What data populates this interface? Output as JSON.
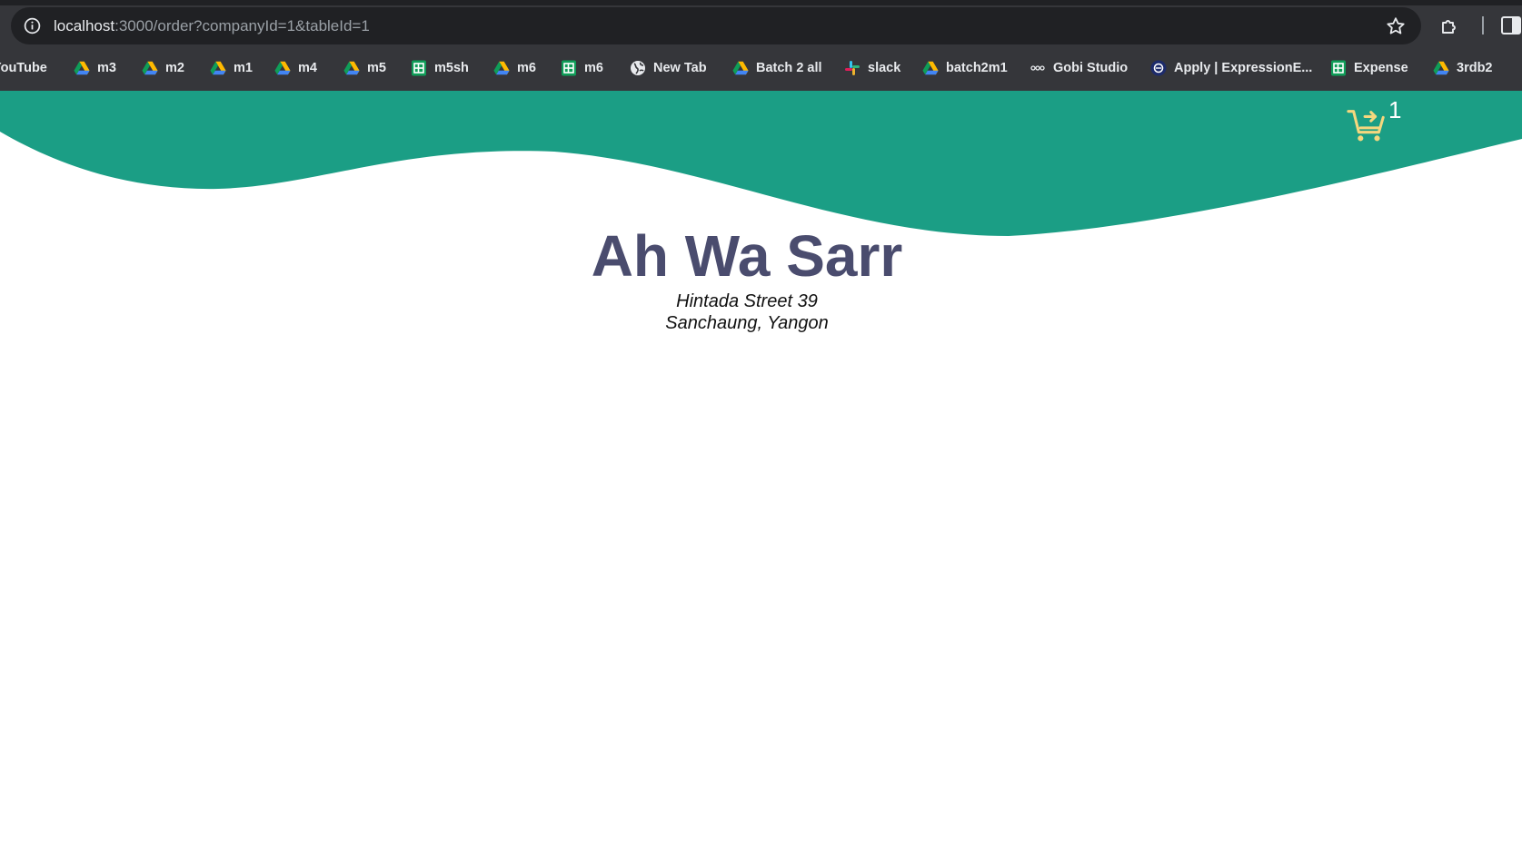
{
  "browser": {
    "url_host": "localhost",
    "url_path": ":3000/order?companyId=1&tableId=1",
    "bookmarks": [
      {
        "label": "YouTube",
        "icon": "youtube-icon"
      },
      {
        "label": "m3",
        "icon": "google-drive-icon"
      },
      {
        "label": "m2",
        "icon": "google-drive-icon"
      },
      {
        "label": "m1",
        "icon": "google-drive-icon"
      },
      {
        "label": "m4",
        "icon": "google-drive-icon"
      },
      {
        "label": "m5",
        "icon": "google-drive-icon"
      },
      {
        "label": "m5sh",
        "icon": "google-sheets-icon"
      },
      {
        "label": "m6",
        "icon": "google-drive-icon"
      },
      {
        "label": "m6",
        "icon": "google-sheets-icon"
      },
      {
        "label": "New Tab",
        "icon": "globe-icon"
      },
      {
        "label": "Batch 2 all",
        "icon": "google-drive-icon"
      },
      {
        "label": "slack",
        "icon": "slack-icon"
      },
      {
        "label": "batch2m1",
        "icon": "google-drive-icon"
      },
      {
        "label": "Gobi Studio",
        "icon": "gobi-icon"
      },
      {
        "label": "Apply | ExpressionE...",
        "icon": "expression-icon"
      },
      {
        "label": "Expense",
        "icon": "google-sheets-icon"
      },
      {
        "label": "3rdb2",
        "icon": "google-drive-icon"
      }
    ]
  },
  "header": {
    "cart_count": "1",
    "cart_icon": "cart-plus-icon",
    "wave_color": "#1b9e85",
    "cart_color": "#f5d77e"
  },
  "restaurant": {
    "name": "Ah Wa Sarr",
    "address_line1": "Hintada Street 39",
    "address_line2": "Sanchaung, Yangon"
  }
}
